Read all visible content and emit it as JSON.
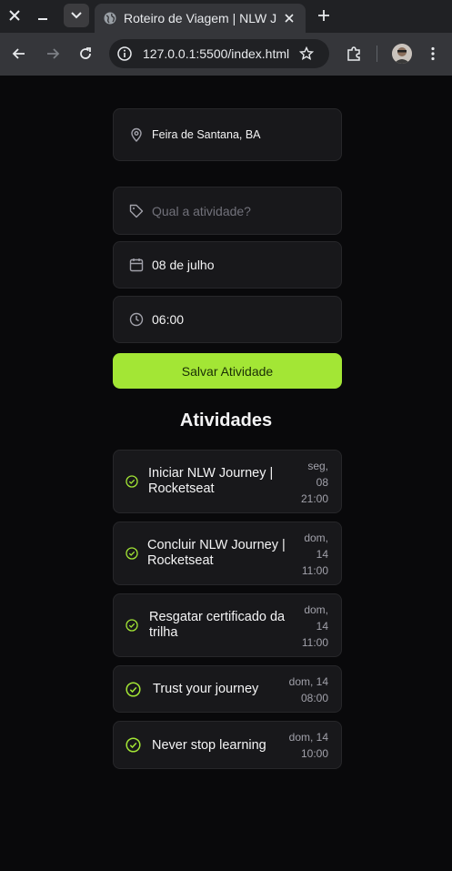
{
  "browser": {
    "tab_title": "Roteiro de Viagem | NLW Journey",
    "url": "127.0.0.1:5500/index.html"
  },
  "location": {
    "value": "Feira de Santana, BA"
  },
  "form": {
    "activity_placeholder": "Qual a atividade?",
    "date_value": "08 de julho",
    "time_value": "06:00",
    "save_label": "Salvar Atividade"
  },
  "activities": {
    "title": "Atividades",
    "items": [
      {
        "label_1": "Iniciar NLW Journey |",
        "label_2": "Rocketseat",
        "date_1": "seg,",
        "date_2": "08",
        "date_3": "21:00"
      },
      {
        "label_1": "Concluir NLW Journey |",
        "label_2": "Rocketseat",
        "date_1": "dom,",
        "date_2": "14",
        "date_3": "11:00"
      },
      {
        "label_1": "Resgatar certificado da",
        "label_2": "trilha",
        "date_1": "dom,",
        "date_2": "14",
        "date_3": "11:00"
      },
      {
        "label_1": "Trust your journey",
        "date_1": "dom, 14",
        "date_2": "08:00"
      },
      {
        "label_1": "Never stop learning",
        "date_1": "dom, 14",
        "date_2": "10:00"
      }
    ]
  },
  "colors": {
    "accent": "#a3e635",
    "background": "#09090b",
    "card": "#18181b"
  }
}
